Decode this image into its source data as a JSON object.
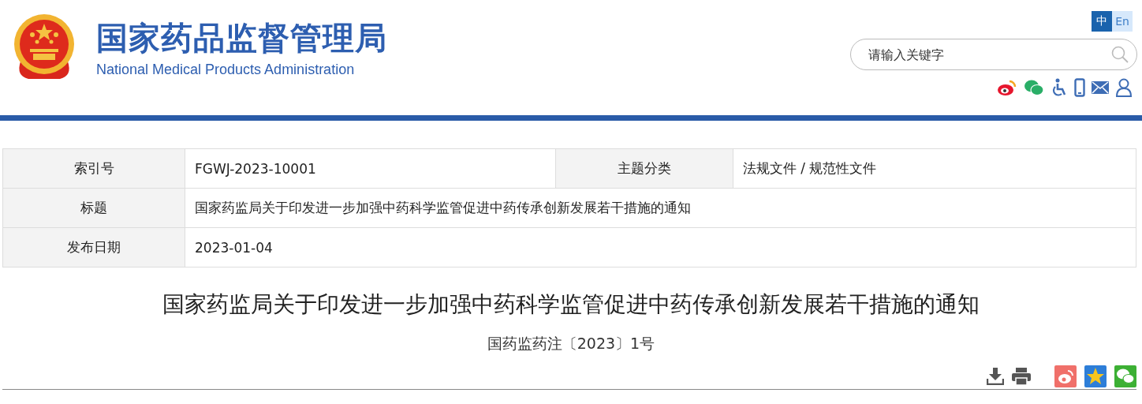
{
  "header": {
    "title_cn": "国家药品监督管理局",
    "title_en": "National Medical Products Administration"
  },
  "languages": [
    {
      "label": "中",
      "selected": true
    },
    {
      "label": "En",
      "selected": false
    }
  ],
  "search": {
    "placeholder": "请输入关键字"
  },
  "info_table": {
    "rows": [
      {
        "cells": [
          {
            "label": "索引号",
            "value": "FGWJ-2023-10001"
          },
          {
            "label": "主题分类",
            "value": "法规文件 / 规范性文件"
          }
        ]
      },
      {
        "cells": [
          {
            "label": "标题",
            "value": "国家药监局关于印发进一步加强中药科学监管促进中药传承创新发展若干措施的通知"
          }
        ]
      },
      {
        "cells": [
          {
            "label": "发布日期",
            "value": "2023-01-04"
          }
        ]
      }
    ]
  },
  "article": {
    "title": "国家药监局关于印发进一步加强中药科学监管促进中药传承创新发展若干措施的通知",
    "doc_number": "国药监药注〔2023〕1号"
  }
}
